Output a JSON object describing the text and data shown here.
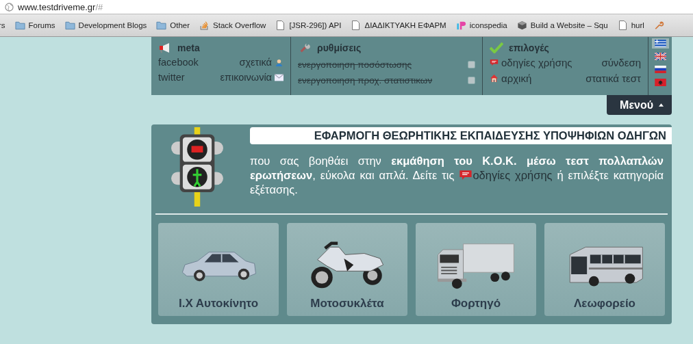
{
  "browser": {
    "url_host": "www.testdriveme.gr",
    "url_path": "/#",
    "bookmarks": [
      {
        "kind": "none",
        "label": "rs"
      },
      {
        "kind": "folder",
        "label": "Forums"
      },
      {
        "kind": "folder",
        "label": "Development Blogs"
      },
      {
        "kind": "folder",
        "label": "Other"
      },
      {
        "kind": "stack",
        "label": "Stack Overflow"
      },
      {
        "kind": "page",
        "label": "[JSR-296]) API"
      },
      {
        "kind": "page",
        "label": "ΔΙΑΔΙΚΤΥΑΚΗ ΕΦΑΡΜ"
      },
      {
        "kind": "ip",
        "label": "iconspedia"
      },
      {
        "kind": "cube",
        "label": "Build a Website – Squ"
      },
      {
        "kind": "page",
        "label": "hurl"
      },
      {
        "kind": "tool"
      }
    ]
  },
  "top_menu": {
    "meta": {
      "title": "meta",
      "links": [
        {
          "label": "facebook",
          "kind": "plain"
        },
        {
          "label": "σχετικά",
          "kind": "person"
        },
        {
          "label": "twitter",
          "kind": "plain"
        },
        {
          "label": "επικοινωνία",
          "kind": "mail"
        }
      ]
    },
    "settings": {
      "title": "ρυθμίσεις",
      "items": [
        {
          "label": "ενεργοποιηση ποσόστωσης",
          "checked": false,
          "disabled": true
        },
        {
          "label": "ενεργοποιηση προχ. στατιστικων",
          "checked": false,
          "disabled": true
        }
      ]
    },
    "options": {
      "title": "επιλογές",
      "links": [
        {
          "label": "οδηγίες χρήσης",
          "kind": "help"
        },
        {
          "label": "σύνδεση",
          "kind": "plain"
        },
        {
          "label": "αρχική",
          "kind": "home"
        },
        {
          "label": "στατικά τεστ",
          "kind": "plain"
        }
      ]
    },
    "languages": [
      {
        "kind": "gr",
        "selected": true
      },
      {
        "kind": "uk",
        "selected": false
      },
      {
        "kind": "ru",
        "selected": false
      },
      {
        "kind": "al",
        "selected": false
      }
    ]
  },
  "menu_button": {
    "label": "Μενού",
    "expanded": true
  },
  "intro": {
    "title": "ΕΦΑΡΜΟΓΗ ΘΕΩΡΗΤΙΚΗΣ ΕΚΠΑΙΔΕΥΣΗΣ ΥΠΟΨΗΦΙΩΝ ΟΔΗΓΩΝ",
    "text_before": "που σας βοηθάει στην **εκμάθηση του Κ.Ο.Κ. μέσω τεστ πολλαπλών ερωτήσεων**, εύκολα και απλά. Δείτε τις ",
    "link": "οδηγίες χρήσης",
    "text_after": " ή επιλέξτε κατηγορία εξέτασης."
  },
  "categories": [
    {
      "kind": "car",
      "label": "Ι.Χ Αυτοκίνητο"
    },
    {
      "kind": "motorcycle",
      "label": "Μοτοσυκλέτα"
    },
    {
      "kind": "truck",
      "label": "Φορτηγό"
    },
    {
      "kind": "bus",
      "label": "Λεωφορείο"
    }
  ]
}
